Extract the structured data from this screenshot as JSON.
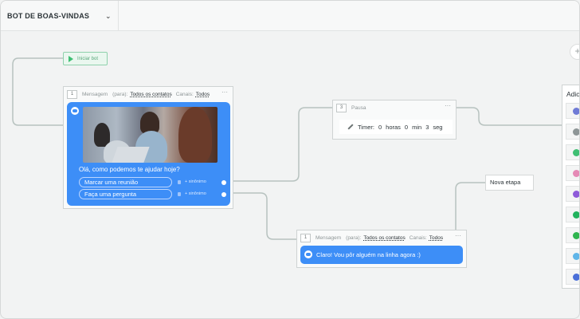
{
  "header": {
    "bot_name": "BOT DE BOAS-VINDAS",
    "dropdown_icon": "chevron-down-icon",
    "zoom_label": "+"
  },
  "start_node": {
    "label": "Iniciar bot",
    "icon": "play-icon"
  },
  "message_node_1": {
    "number": "1",
    "type_label": "Mensagem",
    "to_label": "(para):",
    "to_value": "Todos os contatos",
    "channels_label": "Canais:",
    "channels_value": "Todos",
    "menu": "···",
    "question": "Olá, como podemos te ajudar hoje?",
    "options": [
      {
        "label": "Marcar uma reunião",
        "synonym": "+ sinônimo"
      },
      {
        "label": "Faça uma pergunta",
        "synonym": "+ sinônimo"
      }
    ]
  },
  "pause_node": {
    "number": "3",
    "type_label": "Pausa",
    "menu": "···",
    "timer_label": "Timer:",
    "hours_value": "0",
    "hours_unit": "horas",
    "min_value": "0",
    "min_unit": "min",
    "sec_value": "3",
    "sec_unit": "seg"
  },
  "new_step": {
    "label": "Nova etapa"
  },
  "message_node_2": {
    "number": "1",
    "type_label": "Mensagem",
    "to_label": "(para):",
    "to_value": "Todos os contatos",
    "channels_label": "Canais:",
    "channels_value": "Todos",
    "menu": "···",
    "reply": "Claro! Vou pôr alguém na linha agora :)"
  },
  "add_panel": {
    "title": "Adicionar",
    "icon_colors": [
      "#6f7bd6",
      "#8e9697",
      "#3fbf73",
      "#e58ab6",
      "#8e5bd9",
      "#22b35e",
      "#2fb54f",
      "#5fb5e8",
      "#4a6fd8"
    ]
  },
  "colors": {
    "accent_blue": "#3d8ef7",
    "start_green": "#3fbf73",
    "connector": "#b7c2bf"
  }
}
